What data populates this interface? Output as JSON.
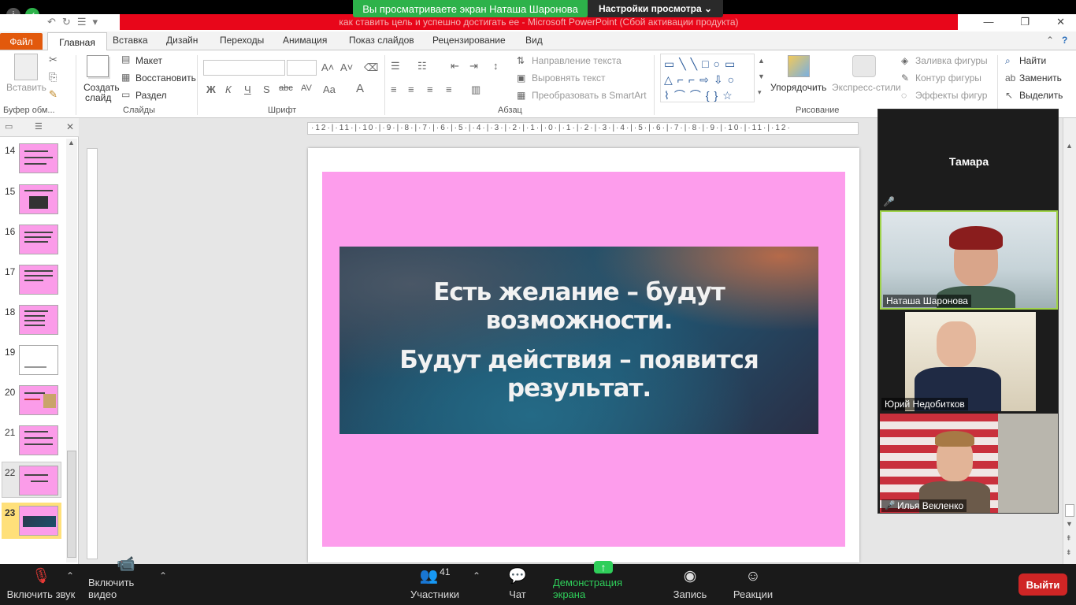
{
  "zoom": {
    "share_banner": "Вы просматриваете экран Наташа Шаронова",
    "view_options": "Настройки просмотра ⌄",
    "participants_tile_name": "Тамара",
    "videos": [
      {
        "name": "Наташа Шаронова"
      },
      {
        "name": "Юрий Недобитков"
      },
      {
        "name": "Илья Векленко"
      }
    ],
    "bottom": {
      "mute": "Включить звук",
      "video": "Включить видео",
      "participants": "Участники",
      "participants_count": "41",
      "chat": "Чат",
      "share": "Демонстрация экрана",
      "record": "Запись",
      "reactions": "Реакции",
      "leave": "Выйти"
    }
  },
  "ppt": {
    "title": "как ставить цель и успешно достигать ее  -  Microsoft PowerPoint (Сбой активации продукта)",
    "tabs": [
      "Файл",
      "Главная",
      "Вставка",
      "Дизайн",
      "Переходы",
      "Анимация",
      "Показ слайдов",
      "Рецензирование",
      "Вид"
    ],
    "groups": {
      "clipboard": "Буфер обм...",
      "slides": "Слайды",
      "font": "Шрифт",
      "paragraph": "Абзац",
      "drawing": "Рисование"
    },
    "buttons": {
      "paste": "Вставить",
      "create_slide_1": "Создать",
      "create_slide_2": "слайд",
      "layout": "Макет",
      "reset": "Восстановить",
      "section": "Раздел",
      "text_direction": "Направление текста",
      "align_text": "Выровнять текст",
      "smartart": "Преобразовать в SmartArt",
      "arrange": "Упорядочить",
      "quick_styles": "Экспресс-стили",
      "shape_fill": "Заливка фигуры",
      "shape_outline": "Контур фигуры",
      "shape_effects": "Эффекты фигур",
      "find": "Найти",
      "replace": "Заменить",
      "select": "Выделить"
    },
    "ruler_h": "·12·|·11·|·10·|·9·|·8·|·7·|·6·|·5·|·4·|·3·|·2·|·1·|·0·|·1·|·2·|·3·|·4·|·5·|·6·|·7·|·8·|·9·|·10·|·11·|·12·",
    "thumbs": [
      "14",
      "15",
      "16",
      "17",
      "18",
      "19",
      "20",
      "21",
      "22",
      "23"
    ],
    "slide_quote_line1": "Есть желание – будут возможности.",
    "slide_quote_line2": "Будут действия – появится результат."
  }
}
